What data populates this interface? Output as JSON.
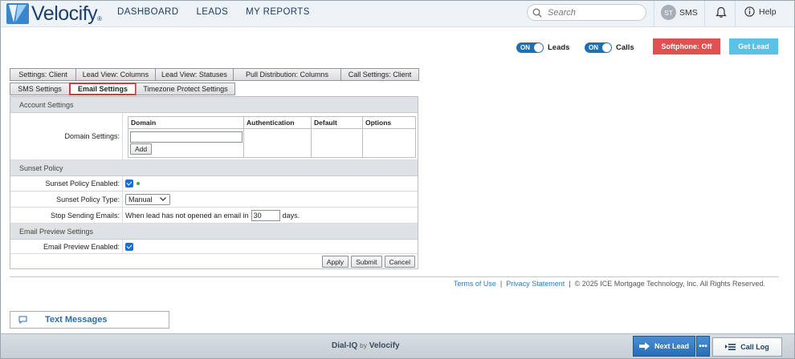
{
  "header": {
    "logo_text": "Velocify",
    "logo_reg": "®",
    "nav": [
      {
        "label": "DASHBOARD"
      },
      {
        "label": "LEADS"
      },
      {
        "label": "MY REPORTS"
      }
    ],
    "search_placeholder": "Search",
    "user_initials": "ST",
    "sms_label": "SMS",
    "help_label": "Help"
  },
  "controls": {
    "leads_toggle": {
      "state": "ON",
      "label": "Leads"
    },
    "calls_toggle": {
      "state": "ON",
      "label": "Calls"
    },
    "softphone_label": "Softphone: Off",
    "get_lead_label": "Get Lead"
  },
  "tabs_row1": [
    {
      "label": "Settings: Client"
    },
    {
      "label": "Lead View: Columns"
    },
    {
      "label": "Lead View: Statuses"
    },
    {
      "label": "Pull Distribution: Columns"
    },
    {
      "label": "Call Settings: Client"
    }
  ],
  "tabs_row2": [
    {
      "label": "SMS Settings"
    },
    {
      "label": "Email Settings",
      "active": true
    },
    {
      "label": "Timezone Protect Settings"
    }
  ],
  "account_settings": {
    "title": "Account Settings",
    "domain_label": "Domain Settings:",
    "columns": [
      "Domain",
      "Authentication",
      "Default",
      "Options"
    ],
    "domain_value": "",
    "add_label": "Add"
  },
  "sunset_policy": {
    "title": "Sunset Policy",
    "enabled_label": "Sunset Policy Enabled:",
    "enabled": true,
    "type_label": "Sunset Policy Type:",
    "type_value": "Manual",
    "stop_label": "Stop Sending Emails:",
    "stop_prefix": "When lead has not opened an email in",
    "stop_days": "30",
    "stop_suffix": "days."
  },
  "email_preview": {
    "title": "Email Preview Settings",
    "enabled_label": "Email Preview Enabled:",
    "enabled": true
  },
  "actions": {
    "apply": "Apply",
    "submit": "Submit",
    "cancel": "Cancel"
  },
  "footer": {
    "terms": "Terms of Use",
    "divider": "|",
    "privacy": "Privacy Statement",
    "copyright": "© 2025 ICE Mortgage Technology, Inc. All Rights Reserved."
  },
  "bottom": {
    "text_messages": "Text Messages",
    "brand_main": "Dial-IQ",
    "brand_by": "by",
    "brand_velocify": "Velocify",
    "next_lead": "Next Lead",
    "more": "•••",
    "call_log": "Call Log"
  },
  "colors": {
    "primary": "#1e6fb4",
    "softphone": "#e05050",
    "get_lead": "#5bc2e7",
    "active_tab_border": "#d33a3a"
  }
}
